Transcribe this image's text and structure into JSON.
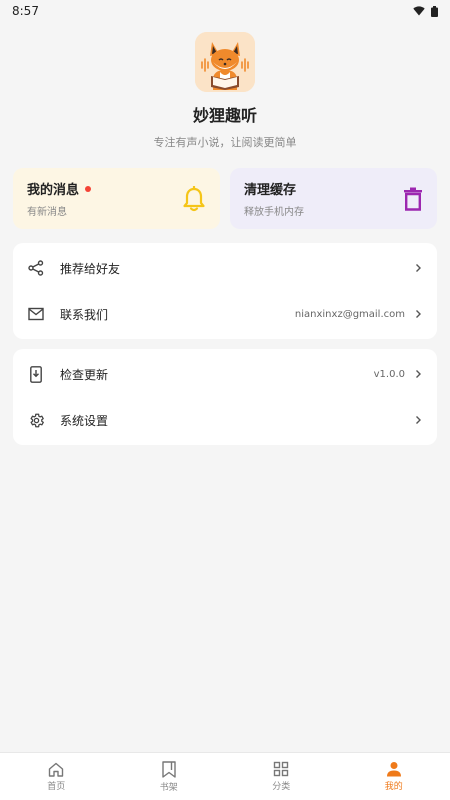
{
  "status_bar": {
    "time": "8:57",
    "icons": [
      "wifi-icon",
      "battery-icon"
    ]
  },
  "app": {
    "name": "妙狸趣听",
    "slogan": "专注有声小说，让阅读更简单",
    "logo_icon": "fox-reading-logo"
  },
  "cards": [
    {
      "title": "我的消息",
      "subtitle": "有新消息",
      "icon": "bell-icon",
      "badge": true,
      "accent": "#f5c518",
      "background": "#fdf6e4"
    },
    {
      "title": "清理缓存",
      "subtitle": "释放手机内存",
      "icon": "trash-icon",
      "accent": "#9c27b0",
      "background": "#efedf9"
    }
  ],
  "groups": [
    {
      "items": [
        {
          "label": "推荐给好友",
          "value": "",
          "icon": "share-icon"
        },
        {
          "label": "联系我们",
          "value": "nianxinxz@gmail.com",
          "icon": "mail-icon"
        }
      ]
    },
    {
      "items": [
        {
          "label": "检查更新",
          "value": "v1.0.0",
          "icon": "phone-download-icon"
        },
        {
          "label": "系统设置",
          "value": "",
          "icon": "gear-icon"
        }
      ]
    }
  ],
  "tabbar": {
    "tabs": [
      {
        "label": "首页",
        "icon": "home-icon"
      },
      {
        "label": "书架",
        "icon": "bookmark-icon"
      },
      {
        "label": "分类",
        "icon": "grid-icon"
      },
      {
        "label": "我的",
        "icon": "person-icon"
      }
    ],
    "active_tab": "我的",
    "active_color": "#ef7a1a",
    "inactive_color": "#888888"
  }
}
